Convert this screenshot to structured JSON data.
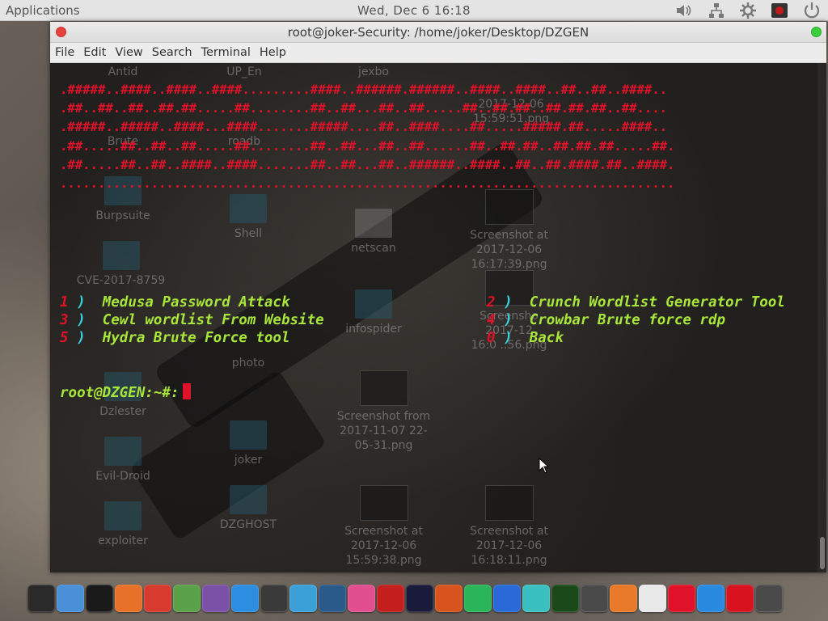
{
  "top_panel": {
    "applications": "Applications",
    "clock": "Wed, Dec  6  16:18",
    "tray": [
      "volume-icon",
      "network-icon",
      "settings-icon",
      "screen-record-icon",
      "power-icon"
    ]
  },
  "window": {
    "title": "root@joker-Security: /home/joker/Desktop/DZGEN",
    "menus": [
      "File",
      "Edit",
      "View",
      "Search",
      "Terminal",
      "Help"
    ]
  },
  "terminal": {
    "banner": [
      ".#####..####..####..####.........####..######.######..####..####..##..##..####..",
      ".##..##..##..##.##.....##........##..##...##..##.....##..##.##..##.##.##..##....",
      ".#####..#####..####...####.......#####....##..####....##.....#####.##.....####..",
      ".##.....##..##..##.....##........##..##...##..##......##..##.##..##.##.##.....##.",
      ".##.....##..##..####..####.......##..##...##..######..####..##..##.####.##..####.",
      "................................................................................."
    ],
    "menu": [
      {
        "num": "1",
        "label": "Medusa Password Attack"
      },
      {
        "num": "2",
        "label": "Crunch Wordlist Generator Tool"
      },
      {
        "num": "3",
        "label": "Cewl wordlist From Website"
      },
      {
        "num": "4",
        "label": "Crowbar Brute force rdp"
      },
      {
        "num": "5",
        "label": "Hydra Brute Force tool"
      },
      {
        "num": "0",
        "label": "Back"
      }
    ],
    "paren": ")",
    "prompt": "root@DZGEN:~#:"
  },
  "desktop_ghost_icons": [
    {
      "label": "Antid"
    },
    {
      "label": "UP_En"
    },
    {
      "label": "jexbo"
    },
    {
      "label": "Brute"
    },
    {
      "label": "roadb"
    },
    {
      "label": "2017-12-06\n15:59:51.png"
    },
    {
      "label": "Burpsuite"
    },
    {
      "label": "Shell"
    },
    {
      "label": "netscan"
    },
    {
      "label": "Screenshot at\n2017-12-06\n16:17:39.png"
    },
    {
      "label": "CVE-2017-8759"
    },
    {
      "label": "infospider"
    },
    {
      "label": "photo"
    },
    {
      "label": "Dzlester"
    },
    {
      "label": "Screenshot from\n2017-11-07 22-\n05-31.png"
    },
    {
      "label": "Evil-Droid"
    },
    {
      "label": "joker"
    },
    {
      "label": "exploiter"
    },
    {
      "label": "DZGHOST"
    },
    {
      "label": "Screenshot at\n2017-12-06\n15:59:38.png"
    },
    {
      "label": "Screenshot at\n2017-12-06\n16:18:11.png"
    },
    {
      "label": "Screensho\n2017-12\n16:0 ..56.png"
    }
  ],
  "dock": [
    {
      "name": "workspace-switcher-icon",
      "color": "#2a2a2a"
    },
    {
      "name": "finder-icon",
      "color": "#4a90d9"
    },
    {
      "name": "terminal-icon",
      "color": "#1a1a1a"
    },
    {
      "name": "firefox-icon",
      "color": "#e8712a"
    },
    {
      "name": "chrome-icon",
      "color": "#d83a2e"
    },
    {
      "name": "globe-icon",
      "color": "#5aa14a"
    },
    {
      "name": "viber-icon",
      "color": "#7b51a8"
    },
    {
      "name": "app-store-icon",
      "color": "#2d8de0"
    },
    {
      "name": "code-editor-icon",
      "color": "#3a3a3a"
    },
    {
      "name": "atom-icon",
      "color": "#3ba0d8"
    },
    {
      "name": "browser-icon",
      "color": "#2a5a8a"
    },
    {
      "name": "itunes-icon",
      "color": "#e14f8f"
    },
    {
      "name": "filezilla-icon",
      "color": "#c41e1e"
    },
    {
      "name": "bull-icon",
      "color": "#1a1a3a"
    },
    {
      "name": "mask-icon",
      "color": "#d8541e"
    },
    {
      "name": "thunder-icon",
      "color": "#2ab55a"
    },
    {
      "name": "malwarebytes-icon",
      "color": "#2a6ad8"
    },
    {
      "name": "anime-avatar-icon",
      "color": "#3ac0c0"
    },
    {
      "name": "monitor-icon",
      "color": "#1a4a1a"
    },
    {
      "name": "dots-icon",
      "color": "#4a4a4a"
    },
    {
      "name": "sublime-icon",
      "color": "#e87a2a"
    },
    {
      "name": "notes-icon",
      "color": "#e8e8e8"
    },
    {
      "name": "diamond-icon",
      "color": "#e0122a"
    },
    {
      "name": "windows-icon",
      "color": "#2a8ae0"
    },
    {
      "name": "record-icon",
      "color": "#d8121e"
    },
    {
      "name": "final-cut-icon",
      "color": "#4a4a4a"
    }
  ]
}
